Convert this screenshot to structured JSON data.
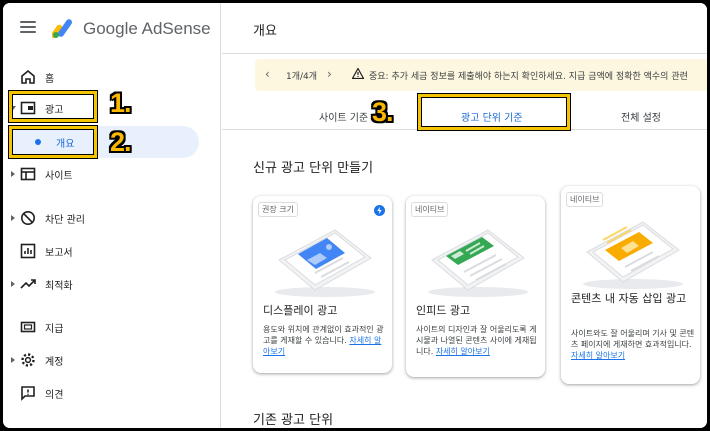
{
  "app": {
    "brand_google": "Google",
    "brand_product": "AdSense"
  },
  "header": {
    "title": "개요"
  },
  "banner": {
    "pager": "1개/4개",
    "message": "중요: 추가 세금 정보를 제출해야 하는지 확인하세요. 지급 금액에 정확한 액수의 관련"
  },
  "sidebar": {
    "items": [
      {
        "label": "홈",
        "icon": "home-icon"
      },
      {
        "label": "광고",
        "icon": "ads-icon"
      },
      {
        "label": "개요",
        "icon": "dot-icon"
      },
      {
        "label": "사이트",
        "icon": "sites-icon"
      },
      {
        "label": "차단 관리",
        "icon": "block-icon"
      },
      {
        "label": "보고서",
        "icon": "reports-icon"
      },
      {
        "label": "최적화",
        "icon": "trending-icon"
      },
      {
        "label": "지급",
        "icon": "payments-icon"
      },
      {
        "label": "계정",
        "icon": "gear-icon"
      },
      {
        "label": "의견",
        "icon": "feedback-icon"
      }
    ]
  },
  "annotations": {
    "step1": "1.",
    "step2": "2.",
    "step3": "3."
  },
  "tabs": [
    {
      "label": "사이트 기준"
    },
    {
      "label": "광고 단위 기준",
      "active": true
    },
    {
      "label": "전체 설정"
    }
  ],
  "sections": {
    "create": "신규 광고 단위 만들기",
    "existing": "기존 광고 단위"
  },
  "cards": [
    {
      "chip": "권장 크기",
      "title": "디스플레이 광고",
      "desc": "용도와 위치에 관계없이 효과적인 광고를 게재할 수 있습니다.",
      "link": "자세히 알아보기"
    },
    {
      "chip": "네이티브",
      "title": "인피드 광고",
      "desc": "사이트의 디자인과 잘 어울리도록 게시물과 나열된 콘텐츠 사이에 게재됩니다.",
      "link": "자세히 알아보기"
    },
    {
      "chip": "네이티브",
      "title": "콘텐츠 내 자동 삽입 광고",
      "desc": "사이트와도 잘 어울리며 기사 및 콘텐츠 페이지에 게재하면 효과적입니다.",
      "link": "자세히 알아보기"
    }
  ],
  "colors": {
    "accent": "#1a73e8",
    "highlight": "#f5c400",
    "banner_bg": "#fef7e0",
    "selected_bg": "#e8f0fe"
  }
}
